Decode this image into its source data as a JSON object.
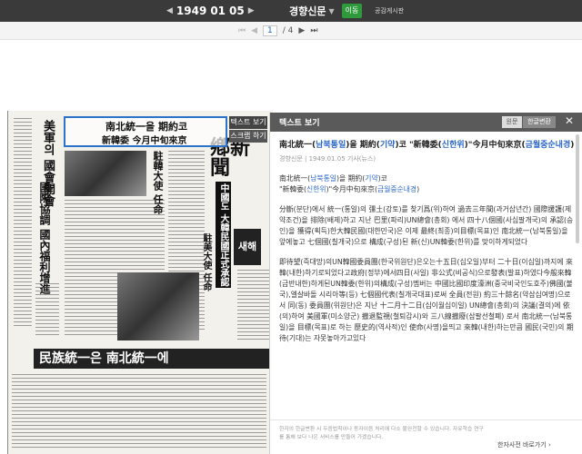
{
  "topbar": {
    "year": "1949",
    "month": "01",
    "day": "05",
    "newspaper": "경향신문",
    "go_label": "이동",
    "share_label": "공감게시판"
  },
  "pager": {
    "current": "1",
    "total": "/ 4"
  },
  "paper": {
    "headline_box_line1": "南北統一을 期約코",
    "headline_box_line2": "新韓委 今月中旬來京",
    "masthead": "鄕新聞",
    "vertical_headline_1": "美軍의 國會開會",
    "vertical_headline_2": "國際協調 國內福利增進",
    "vertical_headline_3": "駐韓大使 任命",
    "vertical_headline_4": "中國도 大韓民國正式承認",
    "vertical_headline_5": "駐美大使 任命",
    "banner": "民族統一은 南北統一에",
    "badge": "새해"
  },
  "side_tabs": {
    "text_view": "텍스트 보기",
    "scrap": "스크랩 하기"
  },
  "panel": {
    "header_title": "텍스트 보기",
    "btn_original": "원문",
    "btn_convert": "한글변환",
    "article_title_a": "南北統一(",
    "article_title_a_blue": "남북통일",
    "article_title_b": ")을 期約(",
    "article_title_b_blue": "기약",
    "article_title_c": ")코 \"新韓委(",
    "article_title_c_blue": "신한위",
    "article_title_d": ")\"今月中旬來京(",
    "article_title_d_blue": "금월중순내경",
    "article_title_e": ")",
    "meta": "경향신문 | 1949.01.05 기사(뉴스)",
    "sub1_a": "南北統一(",
    "sub1_blue": "남북통일",
    "sub1_b": ")을 期約(",
    "sub1_blue2": "기약",
    "sub1_c": ")코",
    "sub2_a": "\"新韓委(",
    "sub2_blue": "신한위",
    "sub2_b": ")\"今月中旬來京(",
    "sub2_blue2": "금월중순내경",
    "sub2_c": ")",
    "para1": "分斷(분단)에서 統一(통일)의 彊土(강토)를 찾기爲(위)하여 過去三年間(과거삼년간) 國際援護(제약조건)을 排除(배제)하고 지난 巴里(파리)UN總會(총회) 에서 四十八個國(사십팔개국)의 承認(승인)을 獲得(획득)한大韓民國(대한민국)은 이제 最終(최종)의目標(목표)인 南北統一(남북통일)을 앞에놓고 七個國(칠개국)으로 構成(구성)된 新(신)UN韓委(한위)를 맞이하게되었다",
    "para2": "即待望(즉대망)의UN韓國委員團(한국위원단)은오는十五日(십오일)부터 二十日(이십일)까지에 來韓(내한)하기로되었다고政府(정부)에서四日(사일) 非公式(비공식)으로發表(발표)하였다今般來韓(금반내한)하게된UN韓委(한위)의構成(구성)멤버는 中國比國印度濠洲(중국비국인도호주)佛國(불국),엘살바돌 시리아等(등) 七個國代表(칠개국대표)로써 全員(전원) 約三十餘名(약삼십여명)으로서 同(동) 委員團(위원단)은 지난 十二月十二日(십이월십이일) UN總會(총회)의 決議(결의)에 依(의)하여 美國軍(미소양군) 撤退監視(철퇴감시)와 三八線撤廢(삼팔선철폐) 로서 南北統一(남북통일)을 目標(목표)로 하는 歷史的(역사적)인 使命(사명)을띄고 來韓(내한)하는만큼 國民(국민)의 期待(기대)는 자못놓아가고있다",
    "footer_note": "한자의 한글변환 시 두음법칙이나 동자이음 처리에 다소 불완전할 수 있습니다. 자유학습 연구를 통해 보다 나은 서비스를 만들어 가겠습니다.",
    "footer_link": "한자사전 바로가기 ›"
  }
}
